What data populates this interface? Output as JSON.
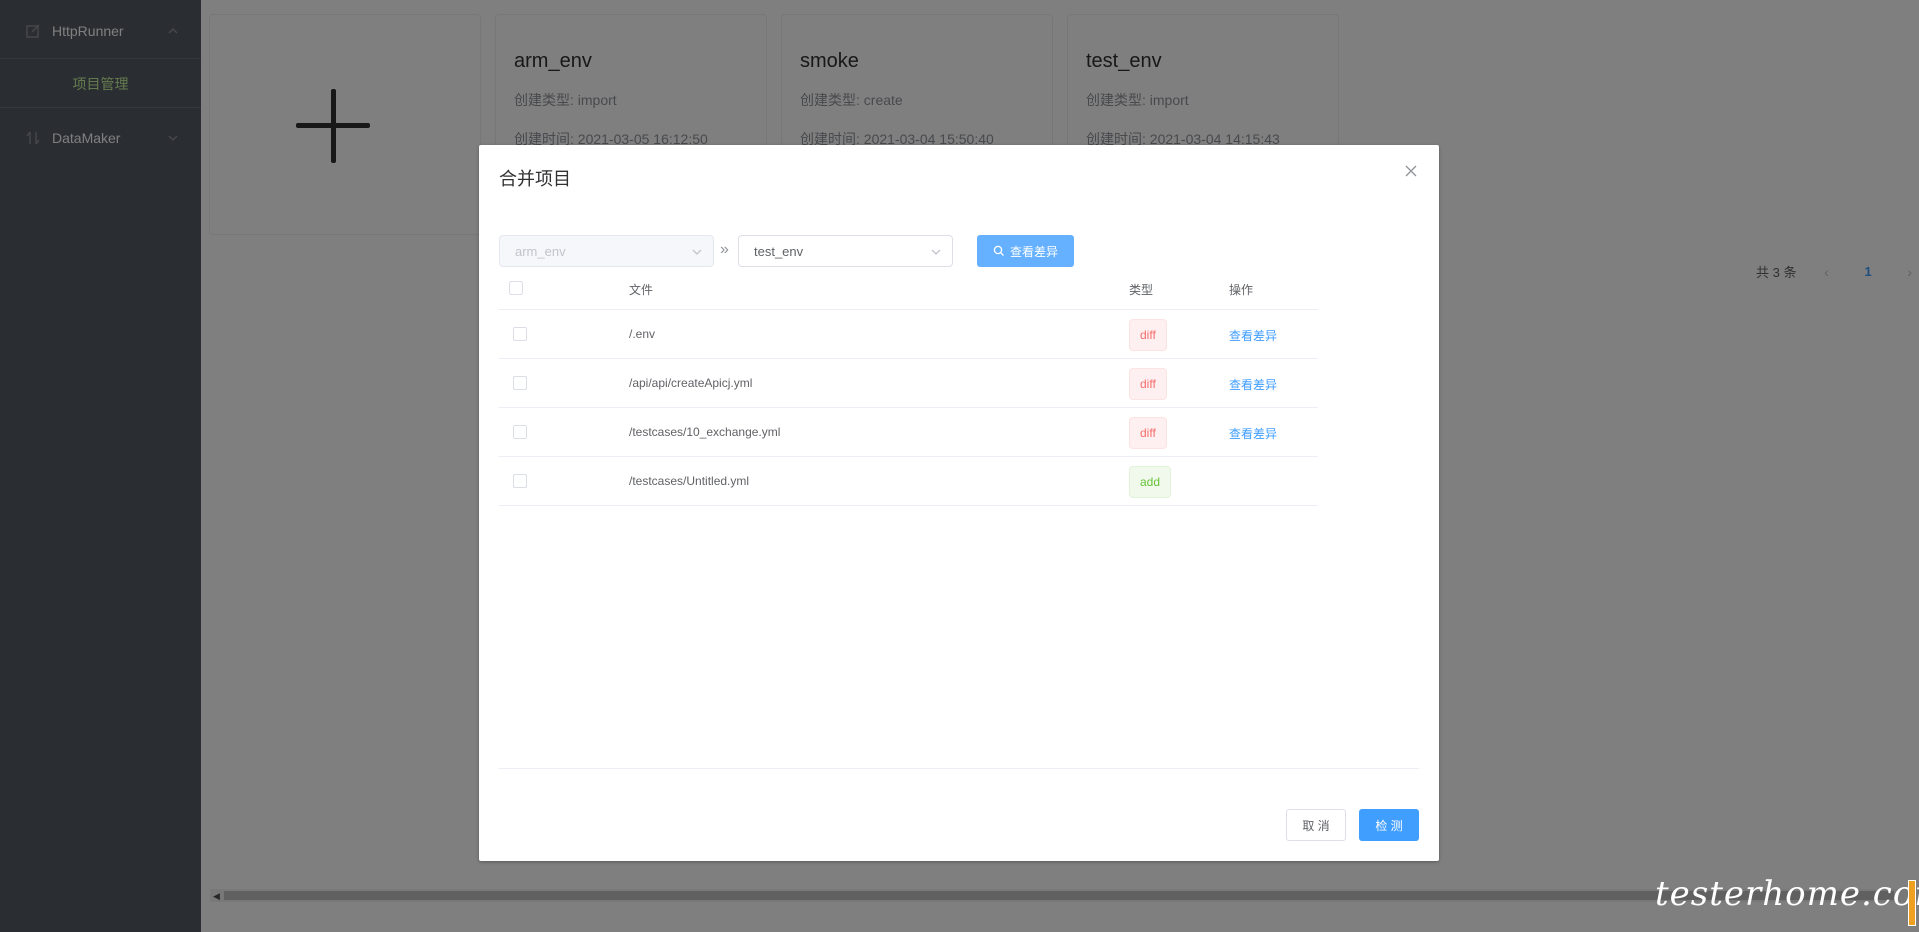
{
  "sidebar": {
    "menus": [
      {
        "label": "HttpRunner",
        "icon": "edit-icon",
        "expanded": true
      },
      {
        "label": "DataMaker",
        "icon": "sort-icon",
        "expanded": false
      }
    ],
    "submenu": {
      "label": "项目管理",
      "color": "#c8f39c"
    }
  },
  "projects": [
    {
      "name": "arm_env",
      "type_label": "创建类型:",
      "type": "import",
      "time_label": "创建时间:",
      "time": "2021-03-05 16:12:50"
    },
    {
      "name": "smoke",
      "type_label": "创建类型:",
      "type": "create",
      "time_label": "创建时间:",
      "time": "2021-03-04 15:50:40"
    },
    {
      "name": "test_env",
      "type_label": "创建类型:",
      "type": "import",
      "time_label": "创建时间:",
      "time": "2021-03-04 14:15:43"
    }
  ],
  "pagination": {
    "total": "共 3 条",
    "current": "1"
  },
  "dialog": {
    "title": "合并项目",
    "source_select": {
      "value": "arm_env",
      "disabled": true
    },
    "target_select": {
      "value": "test_env"
    },
    "diff_button": "查看差异",
    "table": {
      "headers": {
        "file": "文件",
        "type": "类型",
        "op": "操作"
      },
      "rows": [
        {
          "file": "/.env",
          "type": "diff",
          "op": "查看差异"
        },
        {
          "file": "/api/api/createApicj.yml",
          "type": "diff",
          "op": "查看差异"
        },
        {
          "file": "/testcases/10_exchange.yml",
          "type": "diff",
          "op": "查看差异"
        },
        {
          "file": "/testcases/Untitled.yml",
          "type": "add",
          "op": ""
        }
      ]
    },
    "cancel_button": "取 消",
    "check_button": "检 测"
  },
  "watermark": "testerhome.com",
  "colors": {
    "primary": "#409eff",
    "sidebar_bg": "#545c64",
    "diff_tag": "#f56c6c",
    "add_tag": "#67c23a"
  }
}
